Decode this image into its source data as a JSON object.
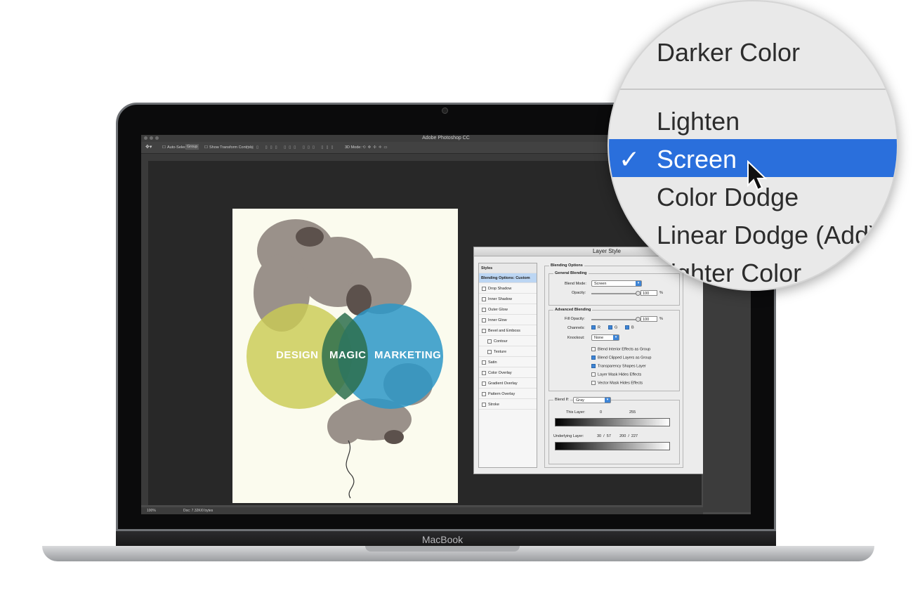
{
  "laptop": {
    "brand": "MacBook"
  },
  "photoshop": {
    "title": "Adobe Photoshop CC",
    "options_bar": {
      "auto_select_label": "Auto-Select:",
      "auto_select_value": "Group",
      "show_transform_label": "Show Transform Controls",
      "mode_label": "3D Mode:"
    },
    "ruler_ticks": [
      "12",
      "11",
      "10",
      "9",
      "8",
      "7",
      "6",
      "5",
      "4",
      "3",
      "2",
      "1",
      "0"
    ],
    "status": {
      "zoom": "100%",
      "doc": "Doc: 7.32K/0 bytes"
    }
  },
  "poster": {
    "word1": "DESIGN",
    "word2": "MAGIC",
    "word3": "MARKETING"
  },
  "layer_style": {
    "title": "Layer Style",
    "styles_header": "Styles",
    "styles": [
      {
        "label": "Blending Options: Custom",
        "selected": true,
        "checkbox": false,
        "indent": false
      },
      {
        "label": "Drop Shadow",
        "checkbox": true,
        "indent": false
      },
      {
        "label": "Inner Shadow",
        "checkbox": true,
        "indent": false
      },
      {
        "label": "Outer Glow",
        "checkbox": true,
        "indent": false
      },
      {
        "label": "Inner Glow",
        "checkbox": true,
        "indent": false
      },
      {
        "label": "Bevel and Emboss",
        "checkbox": true,
        "indent": false
      },
      {
        "label": "Contour",
        "checkbox": true,
        "indent": true
      },
      {
        "label": "Texture",
        "checkbox": true,
        "indent": true
      },
      {
        "label": "Satin",
        "checkbox": true,
        "indent": false
      },
      {
        "label": "Color Overlay",
        "checkbox": true,
        "indent": false
      },
      {
        "label": "Gradient Overlay",
        "checkbox": true,
        "indent": false
      },
      {
        "label": "Pattern Overlay",
        "checkbox": true,
        "indent": false
      },
      {
        "label": "Stroke",
        "checkbox": true,
        "indent": false
      }
    ],
    "blending_options": "Blending Options",
    "general_blending": "General Blending",
    "blend_mode_label": "Blend Mode:",
    "blend_mode_value": "Screen",
    "opacity_label": "Opacity:",
    "opacity_value": "100",
    "advanced_blending": "Advanced Blending",
    "fill_opacity_label": "Fill Opacity:",
    "fill_opacity_value": "100",
    "percent": "%",
    "channels_label": "Channels:",
    "channels": [
      "R",
      "G",
      "B"
    ],
    "knockout_label": "Knockout:",
    "knockout_value": "None",
    "checks": [
      {
        "label": "Blend Interior Effects as Group",
        "checked": false
      },
      {
        "label": "Blend Clipped Layers as Group",
        "checked": true
      },
      {
        "label": "Transparency Shapes Layer",
        "checked": true
      },
      {
        "label": "Layer Mask Hides Effects",
        "checked": false
      },
      {
        "label": "Vector Mask Hides Effects",
        "checked": false
      }
    ],
    "blend_if_label": "Blend If:",
    "blend_if_value": "Gray",
    "this_layer_label": "This Layer:",
    "this_layer_low": "0",
    "this_layer_high": "255",
    "underlying_label": "Underlying Layer:",
    "underlying_values": "30  /  57        200  /  227"
  },
  "magnifier": {
    "items": [
      {
        "label": "Darker Color"
      },
      {
        "label": "Lighten"
      },
      {
        "label": "Screen",
        "checked": true
      },
      {
        "label": "Color Dodge"
      },
      {
        "label": "Linear Dodge (Add)"
      },
      {
        "label": "Lighter Color"
      }
    ],
    "check_mark": "✓"
  },
  "colors": {
    "accent": "#2a6fdc",
    "circle_yellow": "#c9cb54",
    "circle_blue": "#2c97c7",
    "poster_bg": "#fbfbee"
  }
}
